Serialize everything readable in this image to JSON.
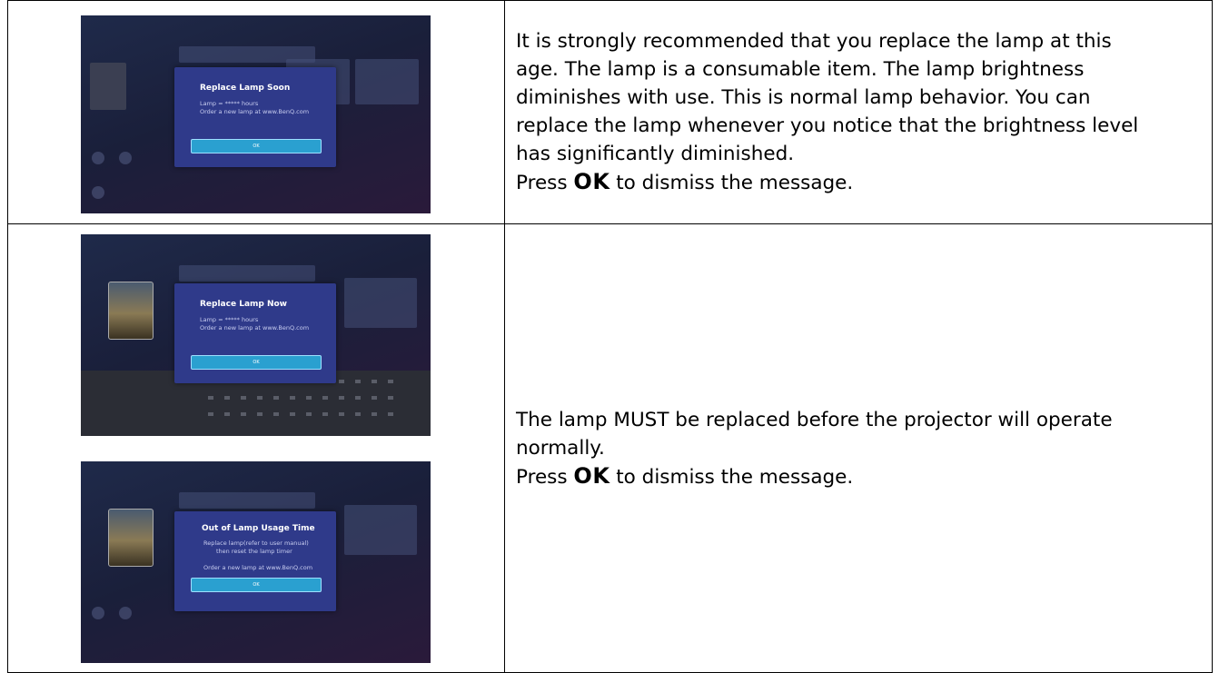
{
  "rows": [
    {
      "screenshot": {
        "dialog_title": "Replace Lamp Soon",
        "dialog_lines": [
          "Lamp = ***** hours",
          "Order a new lamp at www.BenQ.com"
        ],
        "ok_label": "OK"
      },
      "description": {
        "paragraph_lines": [
          "It is strongly recommended that you replace the lamp at this",
          "age. The lamp is a consumable item. The lamp brightness",
          "diminishes with use. This is normal lamp behavior. You can",
          "replace the lamp whenever you notice that the brightness level",
          "has significantly diminished."
        ],
        "press_prefix": "Press ",
        "press_key": "OK",
        "press_suffix": " to dismiss the message."
      }
    },
    {
      "screenshots": [
        {
          "dialog_title": "Replace Lamp Now",
          "dialog_lines": [
            "Lamp = ***** hours",
            "Order a new lamp at www.BenQ.com"
          ],
          "ok_label": "OK"
        },
        {
          "dialog_title": "Out of Lamp Usage Time",
          "dialog_lines": [
            "Replace lamp(refer to user manual)",
            "then reset the lamp timer",
            "",
            "Order a new lamp at www.BenQ.com"
          ],
          "ok_label": "OK"
        }
      ],
      "description": {
        "paragraph_lines": [
          "The lamp MUST be replaced before the projector will operate",
          "normally."
        ],
        "press_prefix": "Press ",
        "press_key": "OK",
        "press_suffix": " to dismiss the message."
      }
    }
  ]
}
